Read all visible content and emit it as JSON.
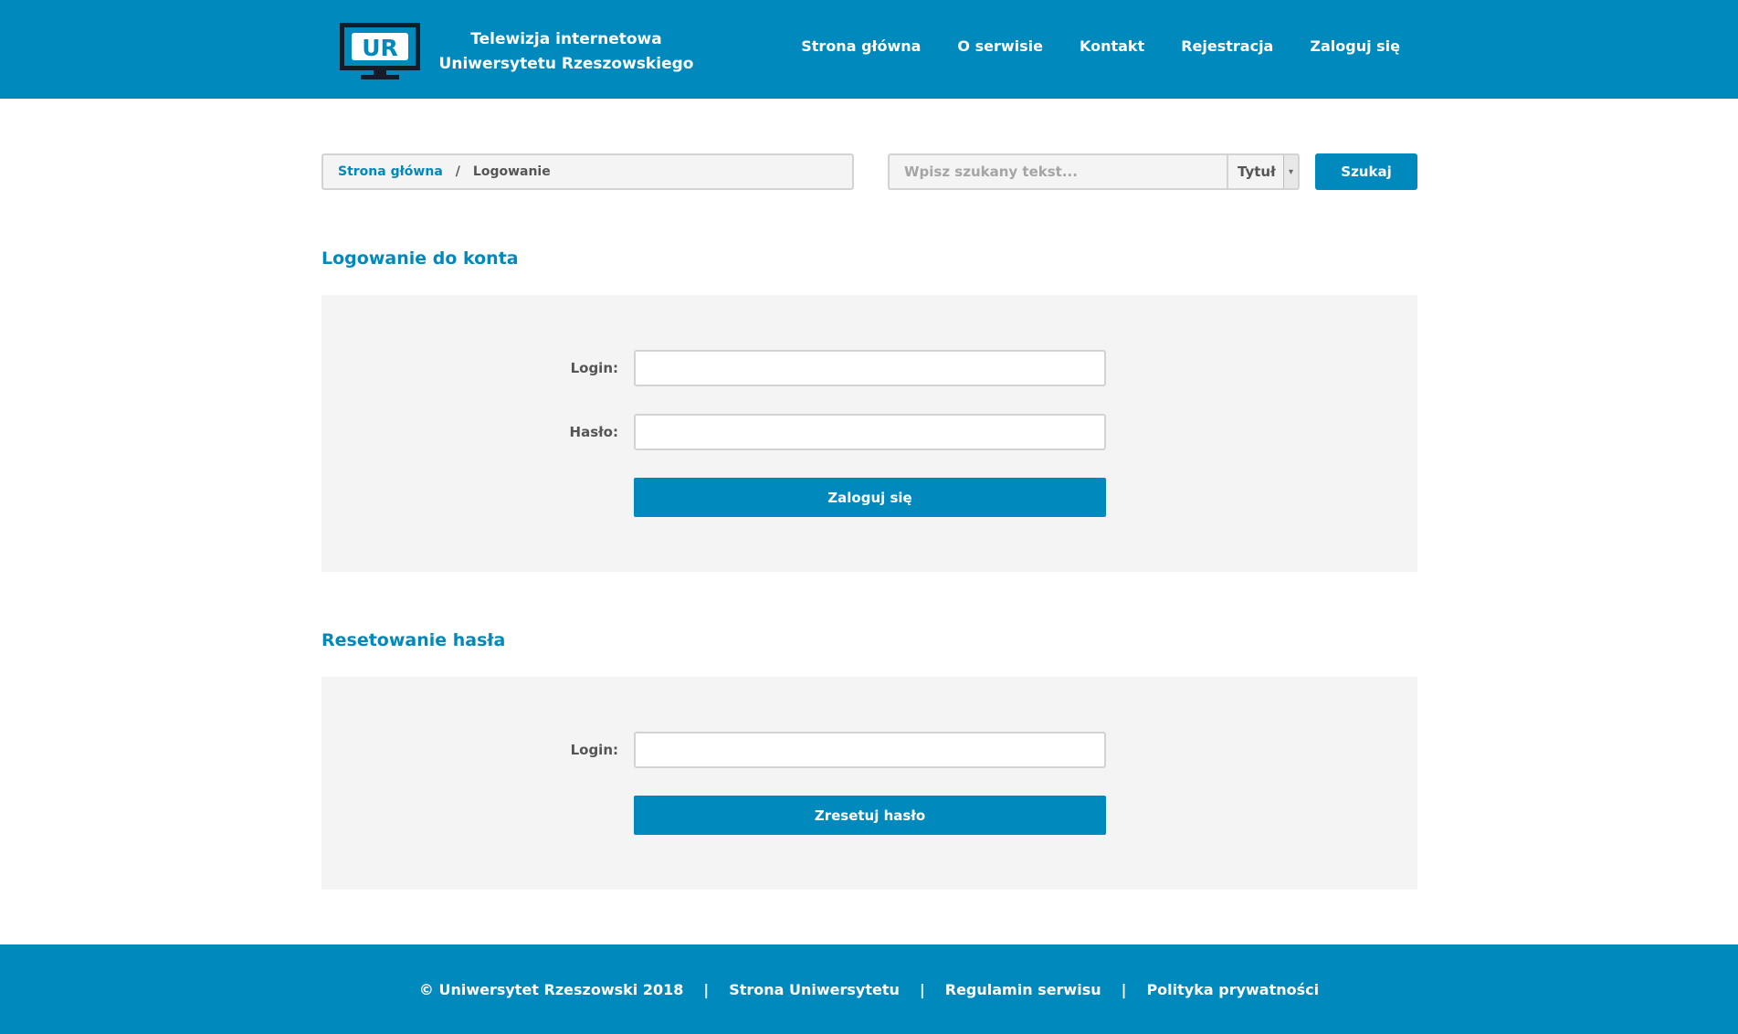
{
  "header": {
    "brand_line1": "Telewizja internetowa",
    "brand_line2": "Uniwersytetu Rzeszowskiego",
    "logo_icon": "ur-tv-logo-icon",
    "logo_text": "UR",
    "nav": [
      {
        "label": "Strona główna"
      },
      {
        "label": "O serwisie"
      },
      {
        "label": "Kontakt"
      },
      {
        "label": "Rejestracja"
      },
      {
        "label": "Zaloguj się"
      }
    ]
  },
  "breadcrumb": {
    "home": "Strona główna",
    "separator": "/",
    "current": "Logowanie"
  },
  "search": {
    "placeholder": "Wpisz szukany tekst...",
    "value": "",
    "select_value": "Tytuł",
    "button_label": "Szukaj"
  },
  "login_section": {
    "title": "Logowanie do konta",
    "login_label": "Login:",
    "login_value": "",
    "password_label": "Hasło:",
    "password_value": "",
    "submit_label": "Zaloguj się"
  },
  "reset_section": {
    "title": "Resetowanie hasła",
    "login_label": "Login:",
    "login_value": "",
    "submit_label": "Zresetuj hasło"
  },
  "footer": {
    "copyright": "© Uniwersytet Rzeszowski 2018",
    "separator": "|",
    "links": [
      {
        "label": "Strona Uniwersytetu"
      },
      {
        "label": "Regulamin serwisu"
      },
      {
        "label": "Polityka prywatności"
      }
    ]
  },
  "colors": {
    "brand": "#0089bd",
    "panel_bg": "#f4f4f4",
    "text": "#555555"
  }
}
